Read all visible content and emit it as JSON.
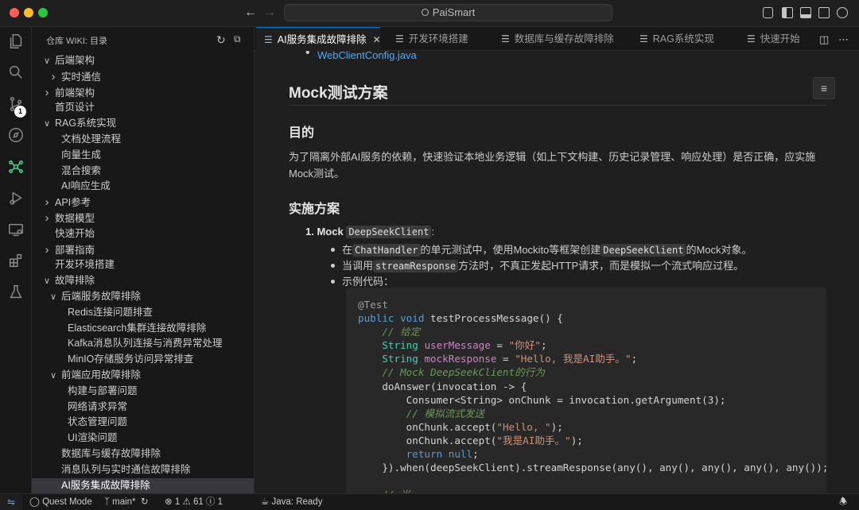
{
  "window": {
    "title": "PaiSmart"
  },
  "sidebar": {
    "title": "仓库 WIKI: 目录",
    "tree": [
      {
        "label": "后端架构",
        "level": 0,
        "chevron": "down"
      },
      {
        "label": "实时通信",
        "level": 1,
        "chevron": "right"
      },
      {
        "label": "前端架构",
        "level": 0,
        "chevron": "right"
      },
      {
        "label": "首页设计",
        "level": 0,
        "chevron": ""
      },
      {
        "label": "RAG系统实现",
        "level": 0,
        "chevron": "down"
      },
      {
        "label": "文档处理流程",
        "level": 1,
        "chevron": ""
      },
      {
        "label": "向量生成",
        "level": 1,
        "chevron": ""
      },
      {
        "label": "混合搜索",
        "level": 1,
        "chevron": ""
      },
      {
        "label": "AI响应生成",
        "level": 1,
        "chevron": ""
      },
      {
        "label": "API参考",
        "level": 0,
        "chevron": "right"
      },
      {
        "label": "数据模型",
        "level": 0,
        "chevron": "right"
      },
      {
        "label": "快速开始",
        "level": 0,
        "chevron": ""
      },
      {
        "label": "部署指南",
        "level": 0,
        "chevron": "right"
      },
      {
        "label": "开发环境搭建",
        "level": 0,
        "chevron": ""
      },
      {
        "label": "故障排除",
        "level": 0,
        "chevron": "down"
      },
      {
        "label": "后端服务故障排除",
        "level": 1,
        "chevron": "down"
      },
      {
        "label": "Redis连接问题排查",
        "level": 2,
        "chevron": ""
      },
      {
        "label": "Elasticsearch集群连接故障排除",
        "level": 2,
        "chevron": ""
      },
      {
        "label": "Kafka消息队列连接与消费异常处理",
        "level": 2,
        "chevron": ""
      },
      {
        "label": "MinIO存储服务访问异常排查",
        "level": 2,
        "chevron": ""
      },
      {
        "label": "前端应用故障排除",
        "level": 1,
        "chevron": "down"
      },
      {
        "label": "构建与部署问题",
        "level": 2,
        "chevron": ""
      },
      {
        "label": "网络请求异常",
        "level": 2,
        "chevron": ""
      },
      {
        "label": "状态管理问题",
        "level": 2,
        "chevron": ""
      },
      {
        "label": "UI渲染问题",
        "level": 2,
        "chevron": ""
      },
      {
        "label": "数据库与缓存故障排除",
        "level": 1,
        "chevron": ""
      },
      {
        "label": "消息队列与实时通信故障排除",
        "level": 1,
        "chevron": ""
      },
      {
        "label": "AI服务集成故障排除",
        "level": 1,
        "chevron": "",
        "selected": true
      }
    ]
  },
  "tabs": [
    {
      "label": "AI服务集成故障排除",
      "active": true
    },
    {
      "label": "开发环境搭建"
    },
    {
      "label": "数据库与缓存故障排除"
    },
    {
      "label": "RAG系统实现"
    },
    {
      "label": "快速开始"
    }
  ],
  "doc": {
    "prev_link": "WebClientConfig.java",
    "h2": "Mock测试方案",
    "h3_goal": "目的",
    "goal_text": "为了隔离外部AI服务的依赖，快速验证本地业务逻辑（如上下文构建、历史记录管理、响应处理）是否正确，应实施Mock测试。",
    "h3_plan": "实施方案",
    "item1_prefix": "1. Mock",
    "item1_code": "DeepSeekClient",
    "item1_suffix": ":",
    "sub1_a": "在",
    "sub1_code1": "ChatHandler",
    "sub1_b": "的单元测试中，使用Mockito等框架创建",
    "sub1_code2": "DeepSeekClient",
    "sub1_c": "的Mock对象。",
    "sub2_a": "当调用",
    "sub2_code": "streamResponse",
    "sub2_b": "方法时，不真正发起HTTP请求，而是模拟一个流式响应过程。",
    "sub3": "示例代码："
  },
  "statusbar": {
    "mode": "Quest Mode",
    "branch": "main*",
    "errors": "1",
    "warnings": "61",
    "infos": "1",
    "java": "Java: Ready"
  }
}
